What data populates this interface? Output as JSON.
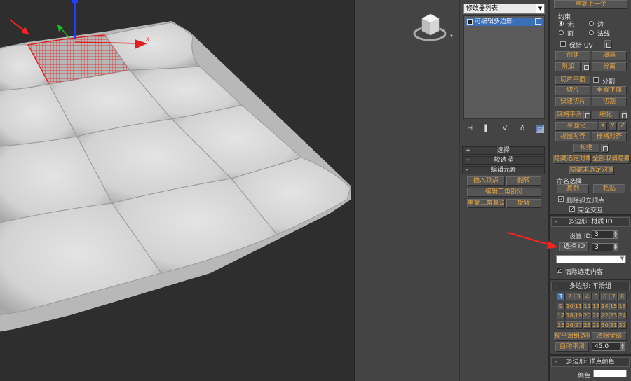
{
  "modifier_panel": {
    "modifier_list": "修改器列表",
    "stack_item": "可编辑多边形",
    "rollouts": {
      "selection": "选择",
      "soft_selection": "软选择",
      "edit_elements": "编辑元素"
    },
    "edit_elements_buttons": {
      "insert_vertex": "插入顶点",
      "flip": "翻转",
      "edit_triangulation": "编辑三角剖分",
      "retriangulate": "重复三角算法",
      "turn": "旋转"
    }
  },
  "command_panel": {
    "repeat_last": "重复上一个",
    "constraints": {
      "label": "约束",
      "none": "无",
      "edge": "边",
      "face": "面",
      "normal": "法线"
    },
    "preserve_uv": "保持 UV",
    "create": "创建",
    "collapse": "塌陷",
    "attach": "附加",
    "detach": "分离",
    "slice_plane": "切片平面",
    "split": "分割",
    "slice": "切片",
    "reset_plane": "重置平面",
    "quickslice": "快速切片",
    "cut": "切割",
    "msmooth": "网格平滑",
    "tessellate": "细化",
    "make_planar": "平面化",
    "x": "X",
    "y": "Y",
    "z": "Z",
    "view_align": "视图对齐",
    "grid_align": "栅格对齐",
    "relax": "松弛",
    "hide_selected": "隐藏选定对象",
    "unhide_all": "全部取消隐藏",
    "hide_unselected": "隐藏未选定对象",
    "named_selections": "命名选择:",
    "copy": "复制",
    "paste": "粘贴",
    "delete_isolated": "删除孤立顶点",
    "full_interactivity": "完全交互",
    "material_ids": {
      "title": "多边形: 材质 ID",
      "set_id_label": "设置 ID:",
      "set_id_value": "3",
      "select_id_label": "选择 ID",
      "select_id_value": "3",
      "clear_selection": "清除选定内容"
    },
    "smoothing_groups": {
      "title": "多边形: 平滑组",
      "numbers": [
        "1",
        "2",
        "3",
        "4",
        "5",
        "6",
        "7",
        "8",
        "9",
        "10",
        "11",
        "12",
        "13",
        "14",
        "15",
        "16",
        "17",
        "18",
        "19",
        "20",
        "21",
        "22",
        "23",
        "24",
        "25",
        "26",
        "27",
        "28",
        "29",
        "30",
        "31",
        "32"
      ],
      "select_by_sg": "按平滑组选择",
      "clear_all": "清除全部",
      "auto_smooth": "自动平滑",
      "auto_smooth_value": "45.0"
    },
    "vertex_colors": {
      "title": "多边形: 顶点颜色",
      "color_label": "颜色"
    }
  },
  "colors": {
    "accent_orange": "#e3a545",
    "selection_red": "#e02020",
    "highlight_blue": "#3b6fb7"
  }
}
